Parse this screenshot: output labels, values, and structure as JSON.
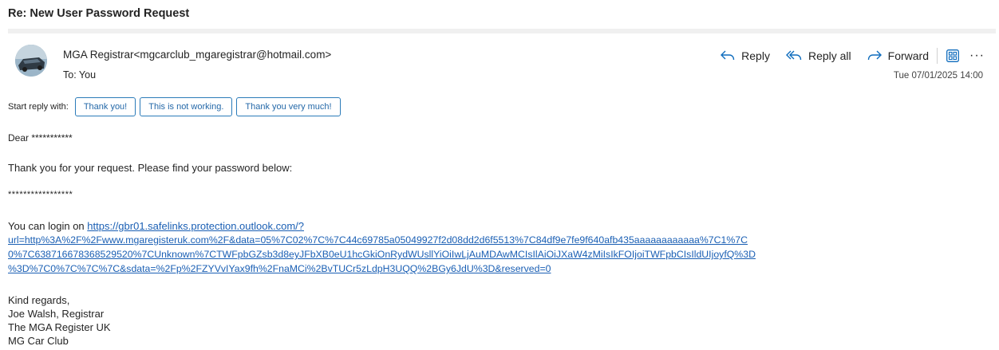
{
  "email": {
    "subject": "Re: New User Password Request",
    "sender": "MGA Registrar<mgcarclub_mgaregistrar@hotmail.com>",
    "to": "To: You",
    "date": "Tue 07/01/2025 14:00"
  },
  "actions": {
    "reply": "Reply",
    "reply_all": "Reply all",
    "forward": "Forward",
    "more": "···"
  },
  "quick_reply": {
    "label": "Start reply with:",
    "options": [
      "Thank you!",
      "This is not working.",
      "Thank you very much!"
    ]
  },
  "body": {
    "greeting": "Dear ***********",
    "line1": "Thank you for your request. Please find your password below:",
    "password": "*****************",
    "login_prefix": "You can login on ",
    "link_lines": [
      "https://gbr01.safelinks.protection.outlook.com/?",
      "url=http%3A%2F%2Fwww.mgaregisteruk.com%2F&data=05%7C02%7C%7C44c69785a05049927f2d08dd2d6f5513%7C84df9e7fe9f640afb435aaaaaaaaaaaa%7C1%7C",
      "0%7C638716678368529520%7CUnknown%7CTWFpbGZsb3d8eyJFbXB0eU1hcGkiOnRydWUsllYiOiIwLjAuMDAwMCIsIlAiOiJXaW4zMiIsIkFOIjoiTWFpbCIsIldUIjoyfQ%3D",
      "%3D%7C0%7C%7C%7C&sdata=%2Fp%2FZYVvIYax9fh%2FnaMCi%2BvTUCr5zLdpH3UQQ%2BGy6JdU%3D&reserved=0"
    ],
    "signoff": [
      "Kind regards,",
      "Joe Walsh, Registrar",
      "The MGA Register UK",
      "MG Car Club"
    ]
  },
  "colors": {
    "accent": "#2b7bb9",
    "link": "#1a5fb4",
    "icon_blue": "#0f6cbd"
  },
  "icons": [
    "reply-icon",
    "reply-all-icon",
    "forward-icon",
    "apps-icon",
    "more-icon",
    "avatar"
  ]
}
